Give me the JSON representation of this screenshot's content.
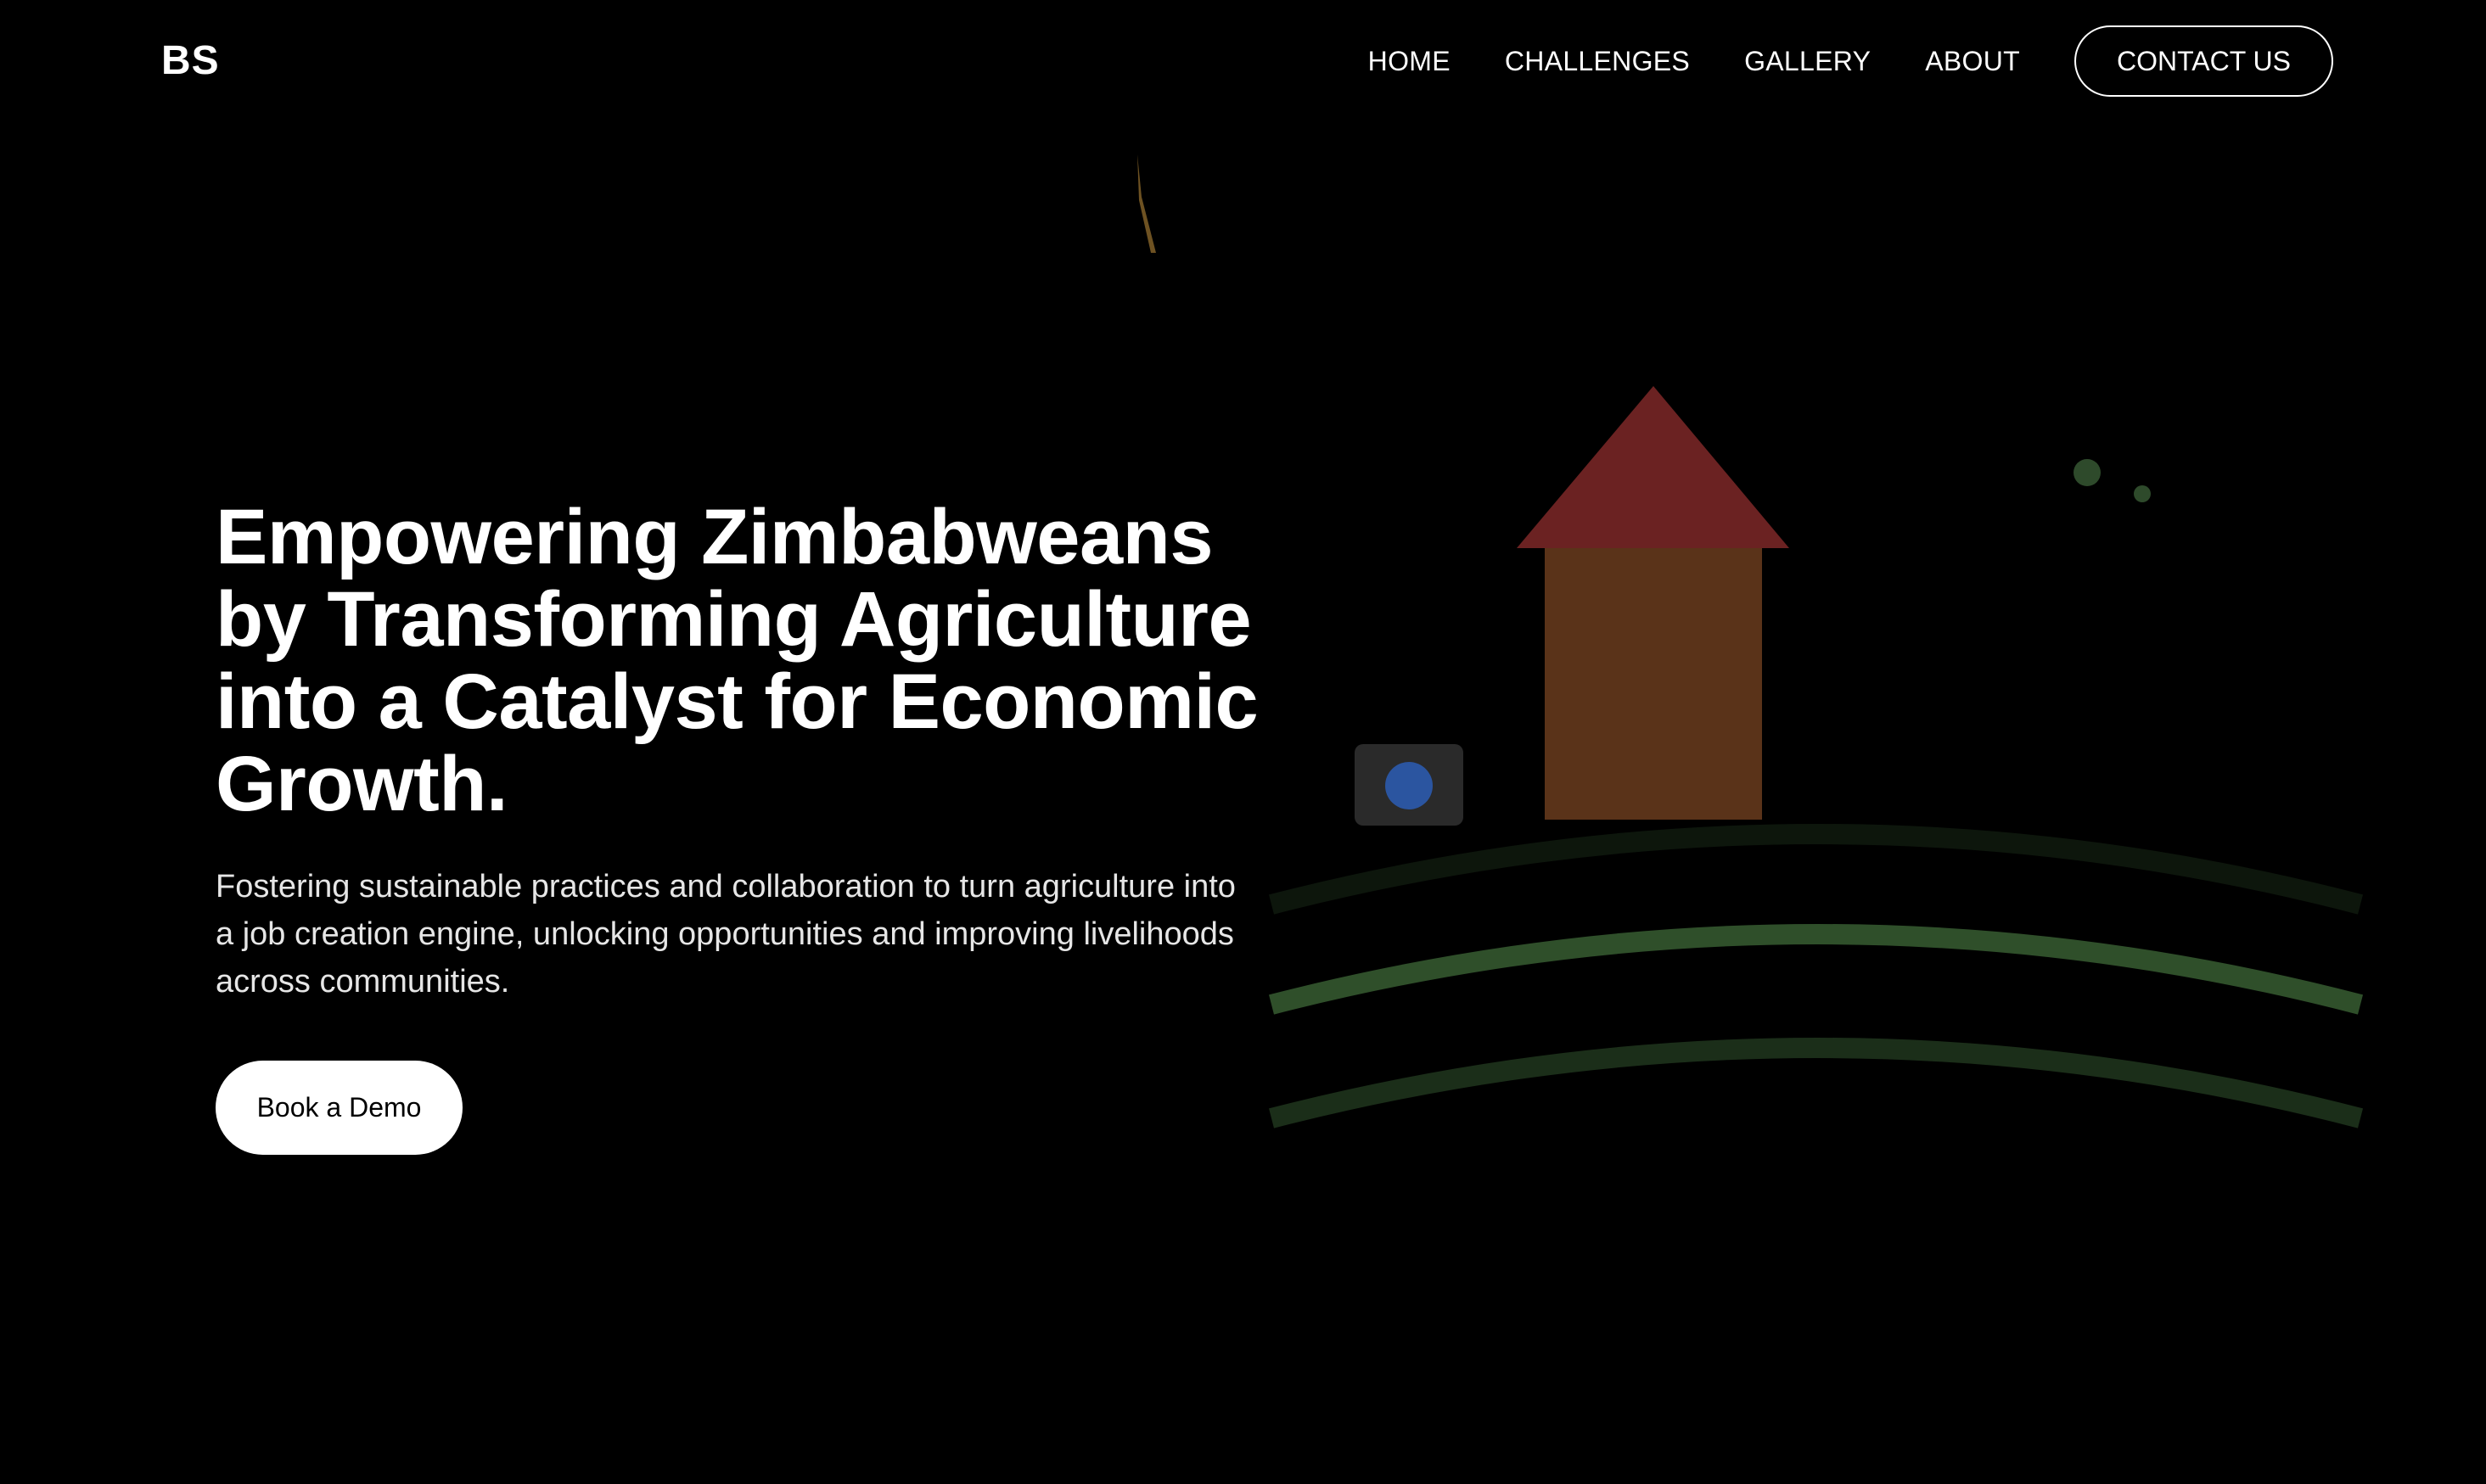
{
  "header": {
    "logo": "BS",
    "nav": [
      {
        "label": "HOME"
      },
      {
        "label": "CHALLENGES"
      },
      {
        "label": "GALLERY"
      },
      {
        "label": "ABOUT"
      }
    ],
    "contact_label": "CONTACT US"
  },
  "hero": {
    "title": "Empowering Zimbabweans by Transforming Agriculture into a Catalyst for Economic Growth.",
    "subtitle": "Fostering sustainable practices and collaboration to turn agriculture into a job creation engine, unlocking opportunities and improving livelihoods across communities.",
    "cta_label": "Book a Demo"
  },
  "illustration": {
    "icons": [
      "house-icon",
      "sun-icon",
      "field-rows",
      "seed-dots",
      "plant-stem"
    ],
    "colors": {
      "roof": "#6b2222",
      "house_body": "#5a3319",
      "field_bright": "#2f4f2a",
      "field_dim": "#1b2e19",
      "field_faint": "#0d160c",
      "sun_box": "#2a2a2a",
      "sun": "#2b55a0",
      "seed": "#2e4a2b",
      "stem": "#6e5222"
    }
  }
}
